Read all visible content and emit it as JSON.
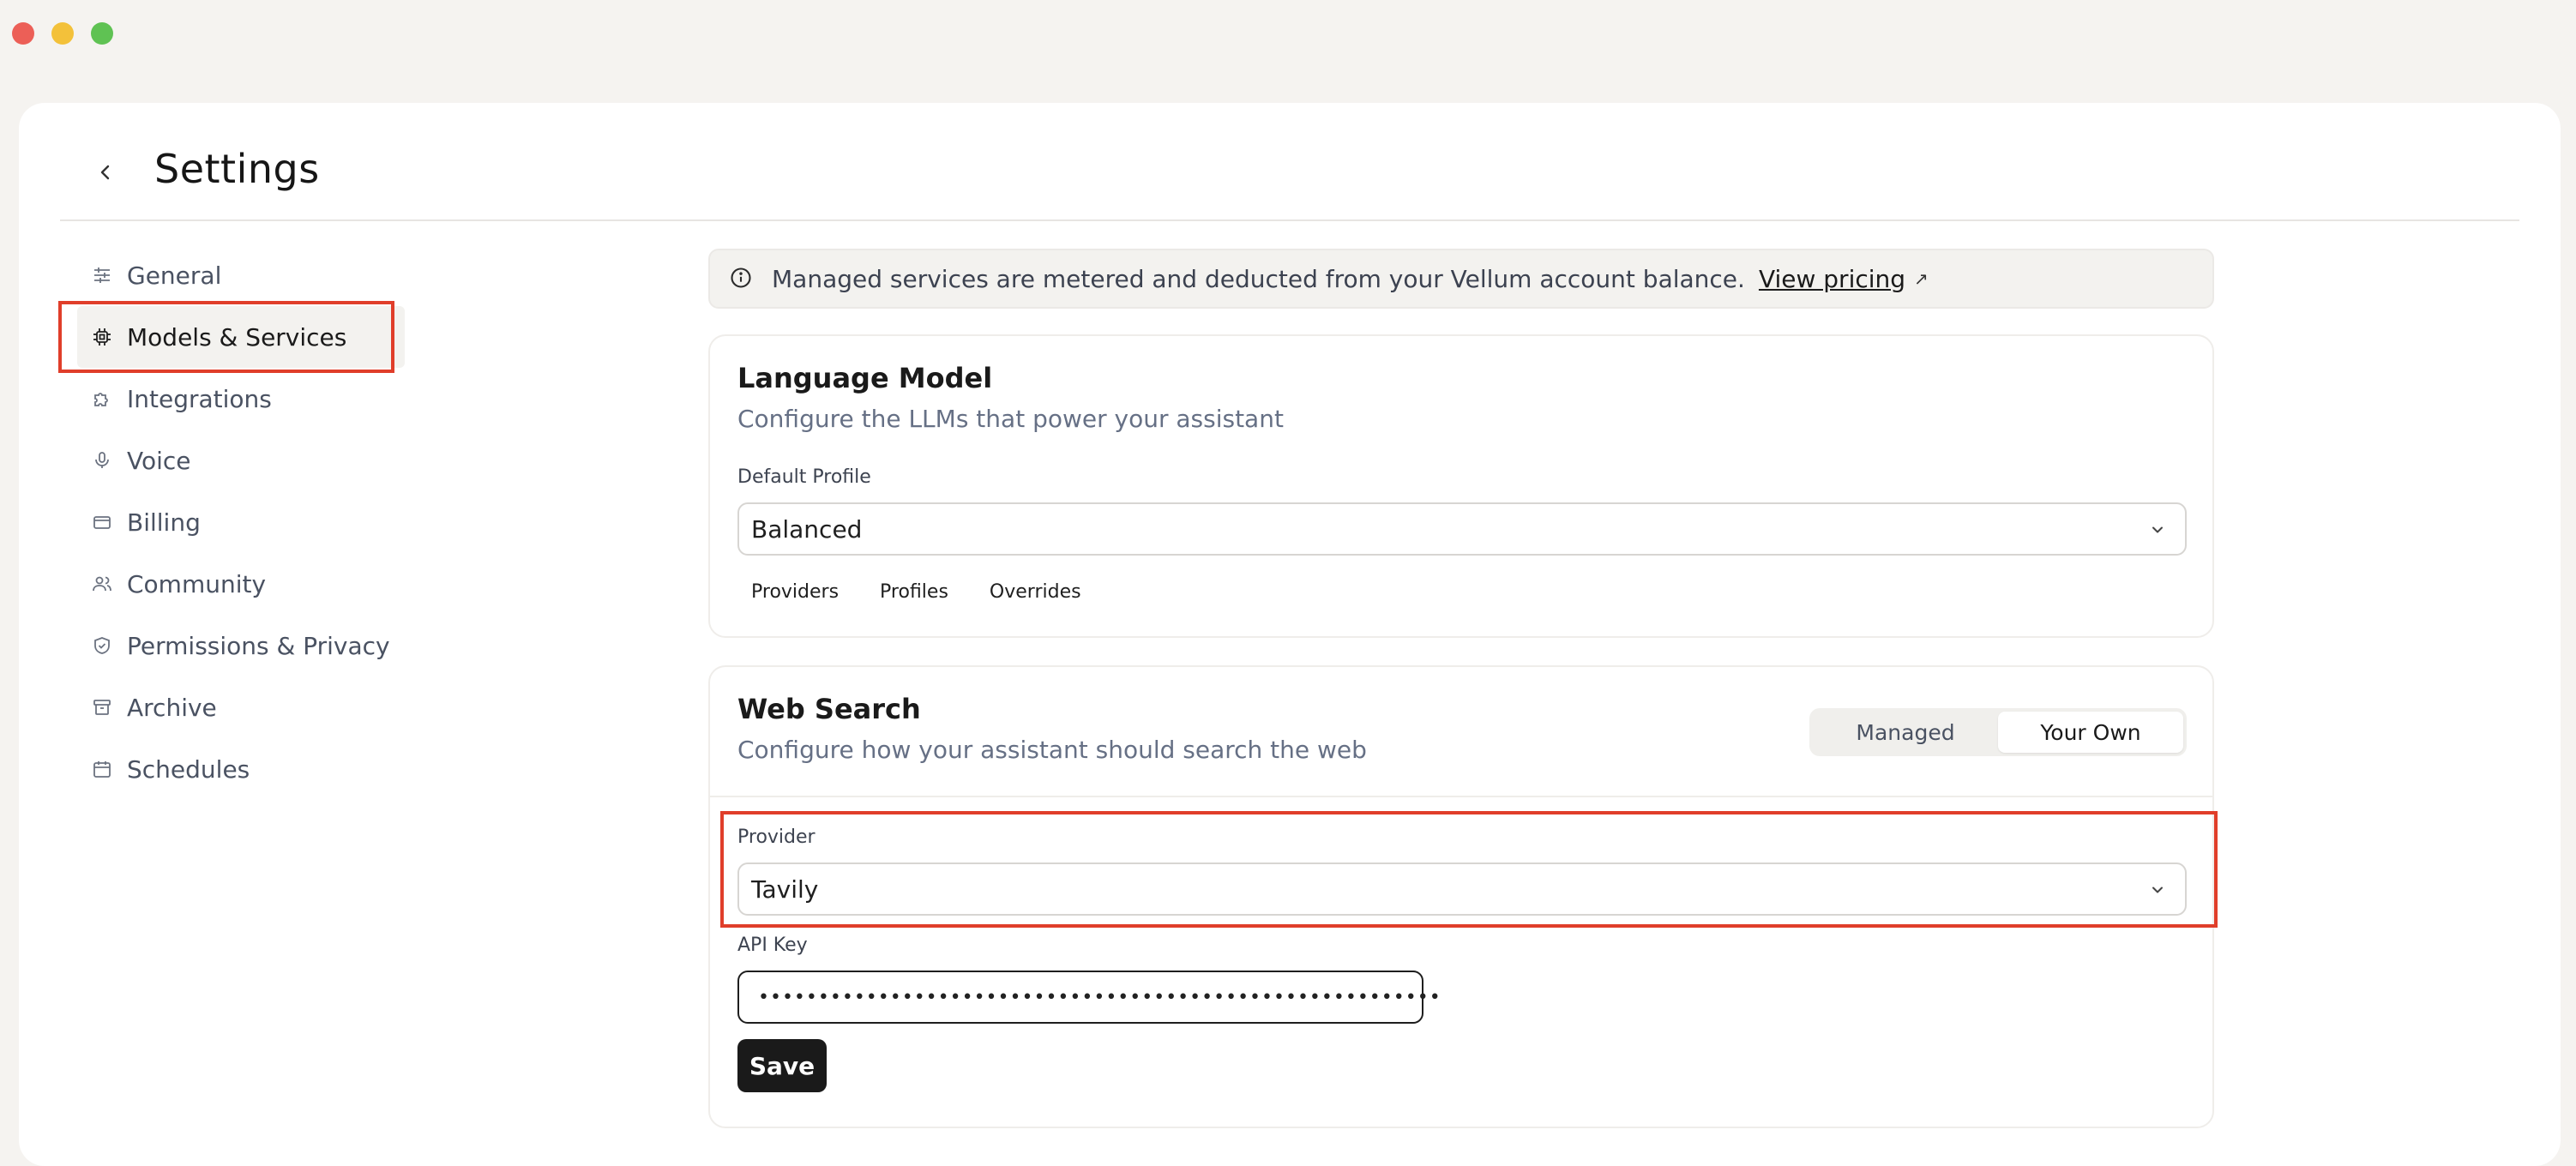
{
  "window": {
    "title": "Settings"
  },
  "sidebar": {
    "items": [
      {
        "label": "General",
        "icon": "sliders-icon"
      },
      {
        "label": "Models & Services",
        "icon": "chip-icon",
        "active": true
      },
      {
        "label": "Integrations",
        "icon": "puzzle-icon"
      },
      {
        "label": "Voice",
        "icon": "microphone-icon"
      },
      {
        "label": "Billing",
        "icon": "credit-card-icon"
      },
      {
        "label": "Community",
        "icon": "users-icon"
      },
      {
        "label": "Permissions & Privacy",
        "icon": "shield-icon"
      },
      {
        "label": "Archive",
        "icon": "archive-icon"
      },
      {
        "label": "Schedules",
        "icon": "calendar-icon"
      }
    ]
  },
  "banner": {
    "text": "Managed services are metered and deducted from your Vellum account balance.",
    "link_label": "View pricing",
    "ext_icon": "↗"
  },
  "language_model": {
    "title": "Language Model",
    "subtitle": "Configure the LLMs that power your assistant",
    "default_profile_label": "Default Profile",
    "default_profile_value": "Balanced",
    "tabs": [
      "Providers",
      "Profiles",
      "Overrides"
    ]
  },
  "web_search": {
    "title": "Web Search",
    "subtitle": "Configure how your assistant should search the web",
    "mode_options": [
      "Managed",
      "Your Own"
    ],
    "mode_selected": "Your Own",
    "provider_label": "Provider",
    "provider_value": "Tavily",
    "api_key_label": "API Key",
    "api_key_value": "•••••••••••••••••••••••••••••••••••••••••••••••••••••••••",
    "save_label": "Save"
  },
  "colors": {
    "highlight": "#e03e2a",
    "accent": "#1a1a1a",
    "background": "#f5f3f0"
  }
}
